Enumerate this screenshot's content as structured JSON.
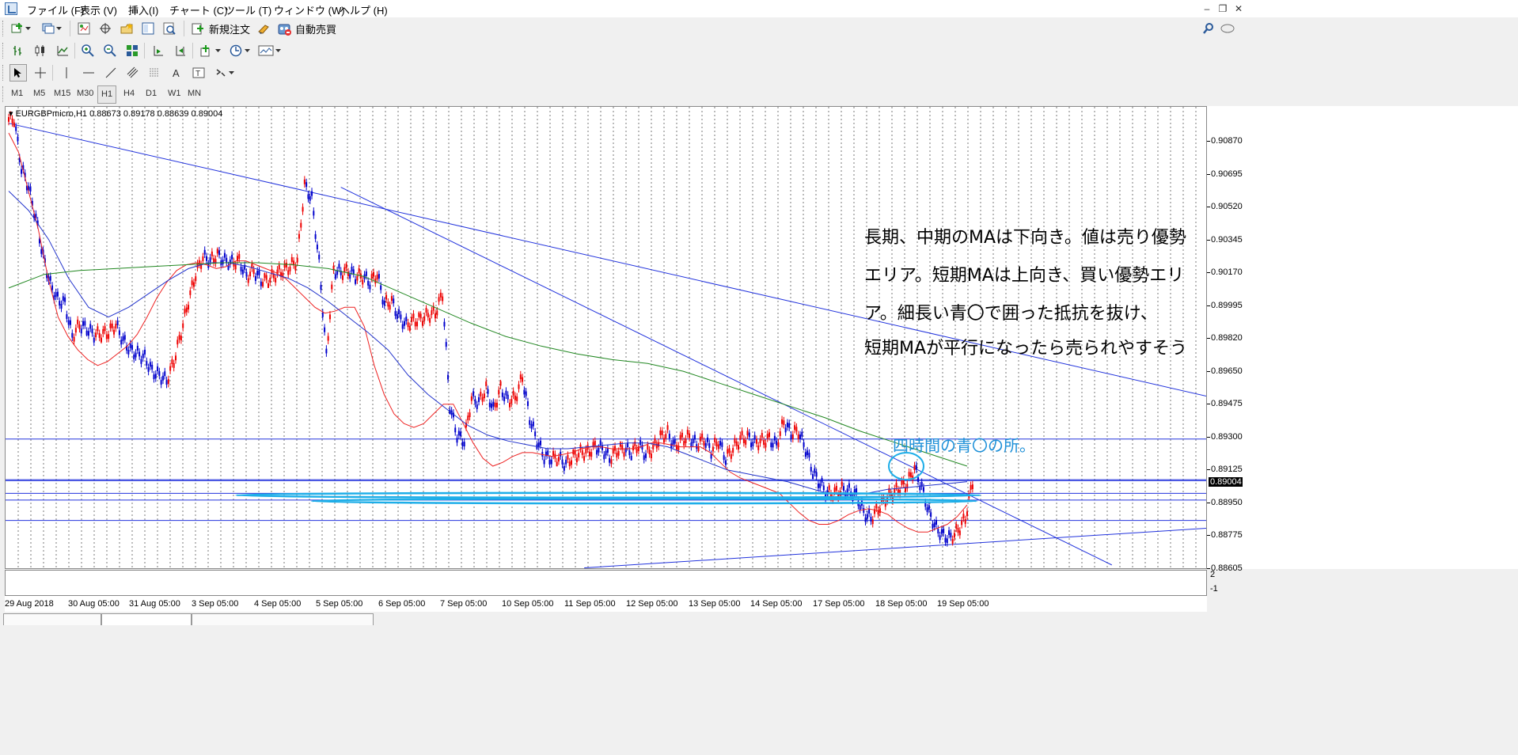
{
  "menu": {
    "items": [
      "ファイル (F)",
      "表示 (V)",
      "挿入(I)",
      "チャート (C)",
      "ツール (T)",
      "ウィンドウ (W)",
      "ヘルプ (H)"
    ]
  },
  "toolbar": {
    "new_order_label": "新規注文",
    "auto_trading_label": "自動売買"
  },
  "timeframes": [
    "M1",
    "M5",
    "M15",
    "M30",
    "H1",
    "H4",
    "D1",
    "W1",
    "MN"
  ],
  "active_timeframe": "H1",
  "chart": {
    "header": "EURGBPmicro,H1  0.88673 0.89178 0.88639 0.89004",
    "current_price": "0.89004",
    "price_labels": [
      "0.90870",
      "0.90695",
      "0.90520",
      "0.90345",
      "0.90170",
      "0.89995",
      "0.89820",
      "0.89650",
      "0.89475",
      "0.89300",
      "0.89125",
      "0.88950",
      "0.88775",
      "0.88605"
    ],
    "time_labels": [
      "29 Aug 2018",
      "30 Aug 05:00",
      "31 Aug 05:00",
      "3 Sep 05:00",
      "4 Sep 05:00",
      "5 Sep 05:00",
      "6 Sep 05:00",
      "7 Sep 05:00",
      "10 Sep 05:00",
      "11 Sep 05:00",
      "12 Sep 05:00",
      "13 Sep 05:00",
      "14 Sep 05:00",
      "17 Sep 05:00",
      "18 Sep 05:00",
      "19 Sep 05:00"
    ],
    "sub_window_labels": [
      "2",
      "-1"
    ]
  },
  "chart_data": {
    "type": "line",
    "title": "EURGBPmicro,H1",
    "ylim": [
      0.88545,
      0.90935
    ],
    "series": [
      {
        "color": "#0000dd",
        "values": [
          0.9087,
          0.9062,
          0.9052,
          0.9036,
          0.9016,
          0.9002,
          0.8994,
          0.8992,
          0.8975,
          0.8981,
          0.8979,
          0.8976,
          0.8976,
          0.8977,
          0.8981,
          0.8973,
          0.8968,
          0.8966,
          0.8964,
          0.8957,
          0.8955,
          0.8952,
          0.8962,
          0.8977,
          0.8993,
          0.9007,
          0.9016,
          0.9014,
          0.9017,
          0.9014,
          0.9013,
          0.9014,
          0.9006,
          0.9009,
          0.9004,
          0.9004,
          0.9007,
          0.9009,
          0.9011,
          0.9014,
          0.9053,
          0.9046,
          0.9013,
          0.8965,
          0.9009,
          0.9008,
          0.9009,
          0.9006,
          0.9006,
          0.9003,
          0.9007,
          0.8992,
          0.8993,
          0.8985,
          0.8981,
          0.8983,
          0.8984,
          0.8986,
          0.8987,
          0.8997,
          0.8939,
          0.8924,
          0.8921,
          0.8943,
          0.8941,
          0.8948,
          0.8937,
          0.8948,
          0.8942,
          0.8943,
          0.8954,
          0.8933,
          0.8921,
          0.8913,
          0.8912,
          0.8912,
          0.8909,
          0.8913,
          0.8915,
          0.8915,
          0.8918,
          0.8917,
          0.8912,
          0.8916,
          0.8917,
          0.8915,
          0.8919,
          0.8914,
          0.8917,
          0.8923,
          0.8925,
          0.8918,
          0.8922,
          0.8923,
          0.8919,
          0.8922,
          0.8916,
          0.8921,
          0.8912,
          0.8917,
          0.8922,
          0.8923,
          0.892,
          0.8921,
          0.8922,
          0.8919,
          0.8931,
          0.8925,
          0.8926,
          0.8917,
          0.8905,
          0.8899,
          0.8894,
          0.8894,
          0.8896,
          0.8895,
          0.8893,
          0.8884,
          0.8881,
          0.8886,
          0.8891,
          0.8894,
          0.8897,
          0.8899,
          0.8907,
          0.8897,
          0.8884,
          0.8876,
          0.8872,
          0.8871,
          0.8875,
          0.8881,
          0.89
        ]
      },
      {
        "color": "#ee2222",
        "values": [
          0.908,
          0.907,
          0.905,
          0.903,
          0.9005,
          0.8985,
          0.8975,
          0.8968,
          0.8963,
          0.896,
          0.8962,
          0.8966,
          0.897,
          0.8976,
          0.8985,
          0.8995,
          0.9003,
          0.9009,
          0.9012,
          0.9013,
          0.9012,
          0.901,
          0.9011,
          0.9014,
          0.9014,
          0.9012,
          0.901,
          0.9008,
          0.9005,
          0.9,
          0.8995,
          0.899,
          0.8987,
          0.8988,
          0.899,
          0.899,
          0.898,
          0.896,
          0.8945,
          0.8935,
          0.893,
          0.8928,
          0.893,
          0.8935,
          0.894,
          0.894,
          0.893,
          0.892,
          0.8912,
          0.8908,
          0.891,
          0.8913,
          0.8915,
          0.8915,
          0.8914,
          0.8913,
          0.8914,
          0.8915,
          0.8917,
          0.8918,
          0.8918,
          0.8917,
          0.8917,
          0.8917,
          0.8918,
          0.892,
          0.892,
          0.8919,
          0.8918,
          0.8918,
          0.8918,
          0.8915,
          0.891,
          0.8905,
          0.8902,
          0.89,
          0.8898,
          0.8896,
          0.8894,
          0.8889,
          0.8884,
          0.888,
          0.8878,
          0.8878,
          0.888,
          0.8883,
          0.8885,
          0.8886,
          0.8885,
          0.8883,
          0.8879,
          0.8876,
          0.8874,
          0.8874,
          0.8876,
          0.8878,
          0.8882,
          0.8888
        ]
      },
      {
        "color": "#2233cc",
        "values": [
          0.905,
          0.904,
          0.9025,
          0.9005,
          0.899,
          0.8985,
          0.899,
          0.8997,
          0.9004,
          0.901,
          0.9013,
          0.9013,
          0.9011,
          0.9008,
          0.9005,
          0.9,
          0.8993,
          0.8985,
          0.8977,
          0.8968,
          0.8955,
          0.8945,
          0.8937,
          0.8929,
          0.8924,
          0.8921,
          0.8919,
          0.8917,
          0.8917,
          0.8918,
          0.8919,
          0.892,
          0.892,
          0.8918,
          0.8914,
          0.891,
          0.8906,
          0.8904,
          0.8902,
          0.89,
          0.8897,
          0.8894,
          0.8893,
          0.8894,
          0.8896,
          0.8897,
          0.8898,
          0.8899,
          0.89
        ]
      },
      {
        "color": "#228822",
        "values": [
          0.9,
          0.9007,
          0.9009,
          0.901,
          0.9011,
          0.9012,
          0.9013,
          0.9013,
          0.9012,
          0.901,
          0.9006,
          0.8998,
          0.899,
          0.8982,
          0.8975,
          0.897,
          0.8966,
          0.8963,
          0.8961,
          0.8957,
          0.8951,
          0.8945,
          0.8939,
          0.8933,
          0.8926,
          0.892,
          0.8914,
          0.8908
        ]
      }
    ]
  },
  "annotations": {
    "note_line1": "長期、中期のMAは下向き。値は売り優勢",
    "note_line2": "エリア。短期MAは上向き、買い優勢エリ",
    "note_line3": "ア。細長い青〇で囲った抵抗を抜け、",
    "note_line4": "短期MAが平行になったら売られやすそう",
    "blue_note": "四時間の青〇の所。"
  },
  "colors": {
    "bull": "#ee0000",
    "bear": "#0000cc",
    "trendline": "#2233dd",
    "highlight": "#1eaee8"
  }
}
